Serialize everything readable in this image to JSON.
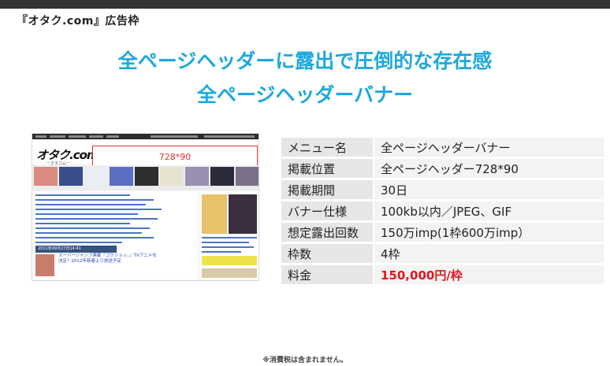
{
  "header": {
    "title": "『オタク.com』広告枠"
  },
  "headline": {
    "line1": "全ページヘッダーに露出で圧倒的な存在感",
    "line2": "全ページヘッダーバナー"
  },
  "preview": {
    "logo": "オタク.com",
    "logo_sub": "ーオタコムー",
    "banner_size": "728*90",
    "date": "2011年09月27日14:41",
    "news_text": "スーパージャンプ連載『ゴクジョッ。』TVアニメ化決定！2012年新春より放送予定"
  },
  "specs": [
    {
      "label": "メニュー名",
      "value": "全ページヘッダーバナー"
    },
    {
      "label": "掲載位置",
      "value": "全ページヘッダー728*90"
    },
    {
      "label": "掲載期間",
      "value": "30日"
    },
    {
      "label": "バナー仕様",
      "value": "100kb以内／JPEG、GIF"
    },
    {
      "label": "想定露出回数",
      "value": "150万imp(1枠600万imp）"
    },
    {
      "label": "枠数",
      "value": "4枠"
    },
    {
      "label": "料金",
      "value": "150,000円/枠"
    }
  ],
  "footnote": "※消費税は含まれません。",
  "colors": {
    "accent": "#1ea8dd",
    "price": "#e0161b",
    "topbar": "#333333"
  }
}
